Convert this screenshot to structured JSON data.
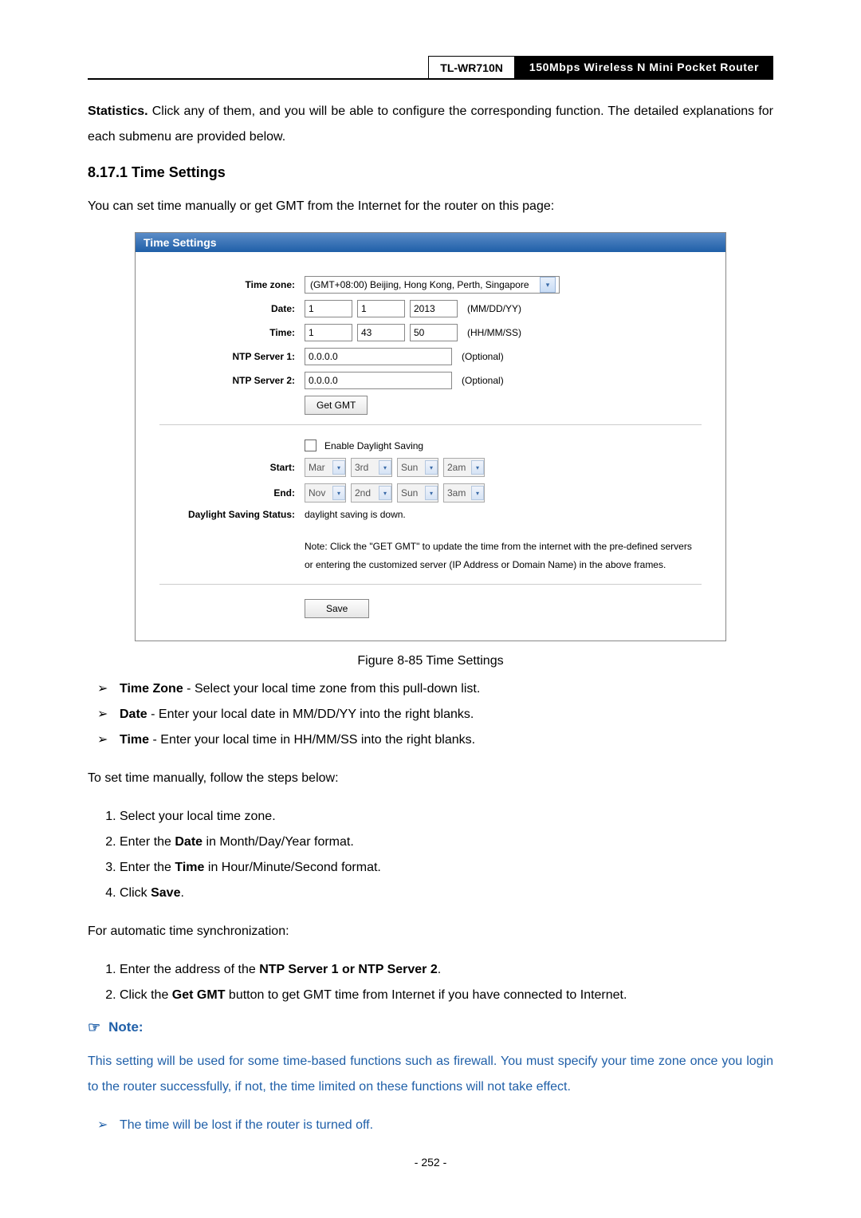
{
  "header": {
    "model": "TL-WR710N",
    "title": "150Mbps Wireless N Mini Pocket Router"
  },
  "intro_paragraph_prefix": "Statistics.",
  "intro_paragraph_rest": " Click any of them, and you will be able to configure the corresponding function. The detailed explanations for each submenu are provided below.",
  "section_heading": "8.17.1 Time Settings",
  "section_intro": "You can set time manually or get GMT from the Internet for the router on this page:",
  "screenshot": {
    "title": "Time Settings",
    "labels": {
      "timezone": "Time zone:",
      "date": "Date:",
      "time": "Time:",
      "ntp1": "NTP Server 1:",
      "ntp2": "NTP Server 2:",
      "start": "Start:",
      "end": "End:",
      "ds_status": "Daylight Saving Status:"
    },
    "timezone_value": "(GMT+08:00) Beijing, Hong Kong, Perth, Singapore",
    "date": {
      "m": "1",
      "d": "1",
      "y": "2013",
      "hint": "(MM/DD/YY)"
    },
    "time": {
      "h": "1",
      "m": "43",
      "s": "50",
      "hint": "(HH/MM/SS)"
    },
    "ntp1": "0.0.0.0",
    "ntp2": "0.0.0.0",
    "optional": "(Optional)",
    "get_gmt": "Get GMT",
    "enable_ds": "Enable Daylight Saving",
    "start_vals": {
      "a": "Mar",
      "b": "3rd",
      "c": "Sun",
      "d": "2am"
    },
    "end_vals": {
      "a": "Nov",
      "b": "2nd",
      "c": "Sun",
      "d": "3am"
    },
    "ds_status": "daylight saving is down.",
    "note_line1": "Note: Click the \"GET GMT\" to update the time from the internet with the pre-defined servers",
    "note_line2": "or entering the customized server (IP Address or Domain Name) in the above frames.",
    "save": "Save"
  },
  "figure_caption": "Figure 8-85 Time Settings",
  "bullets": [
    {
      "b": "Time Zone",
      "t": " - Select your local time zone from this pull-down list."
    },
    {
      "b": "Date",
      "t": " - Enter your local date in MM/DD/YY into the right blanks."
    },
    {
      "b": "Time",
      "t": " - Enter your local time in HH/MM/SS into the right blanks."
    }
  ],
  "manual_intro": "To set time manually, follow the steps below:",
  "manual_steps": {
    "s1": "Select your local time zone.",
    "s2_a": "Enter the ",
    "s2_b": "Date",
    "s2_c": " in Month/Day/Year format.",
    "s3_a": "Enter the ",
    "s3_b": "Time",
    "s3_c": " in Hour/Minute/Second format.",
    "s4_a": "Click ",
    "s4_b": "Save",
    "s4_c": "."
  },
  "auto_intro": "For automatic time synchronization:",
  "auto_steps": {
    "s1_a": "Enter the address of the ",
    "s1_b": "NTP Server 1 or NTP Server 2",
    "s1_c": ".",
    "s2_a": "Click the ",
    "s2_b": "Get GMT",
    "s2_c": " button to get GMT time from Internet if you have connected to Internet."
  },
  "note_heading": "Note:",
  "note_body": "This setting will be used for some time-based functions such as firewall. You must specify your time zone once you login to the router successfully, if not, the time limited on these functions will not take effect.",
  "note_bullets": {
    "n1": "The time will be lost if the router is turned off."
  },
  "page_number": "- 252 -"
}
